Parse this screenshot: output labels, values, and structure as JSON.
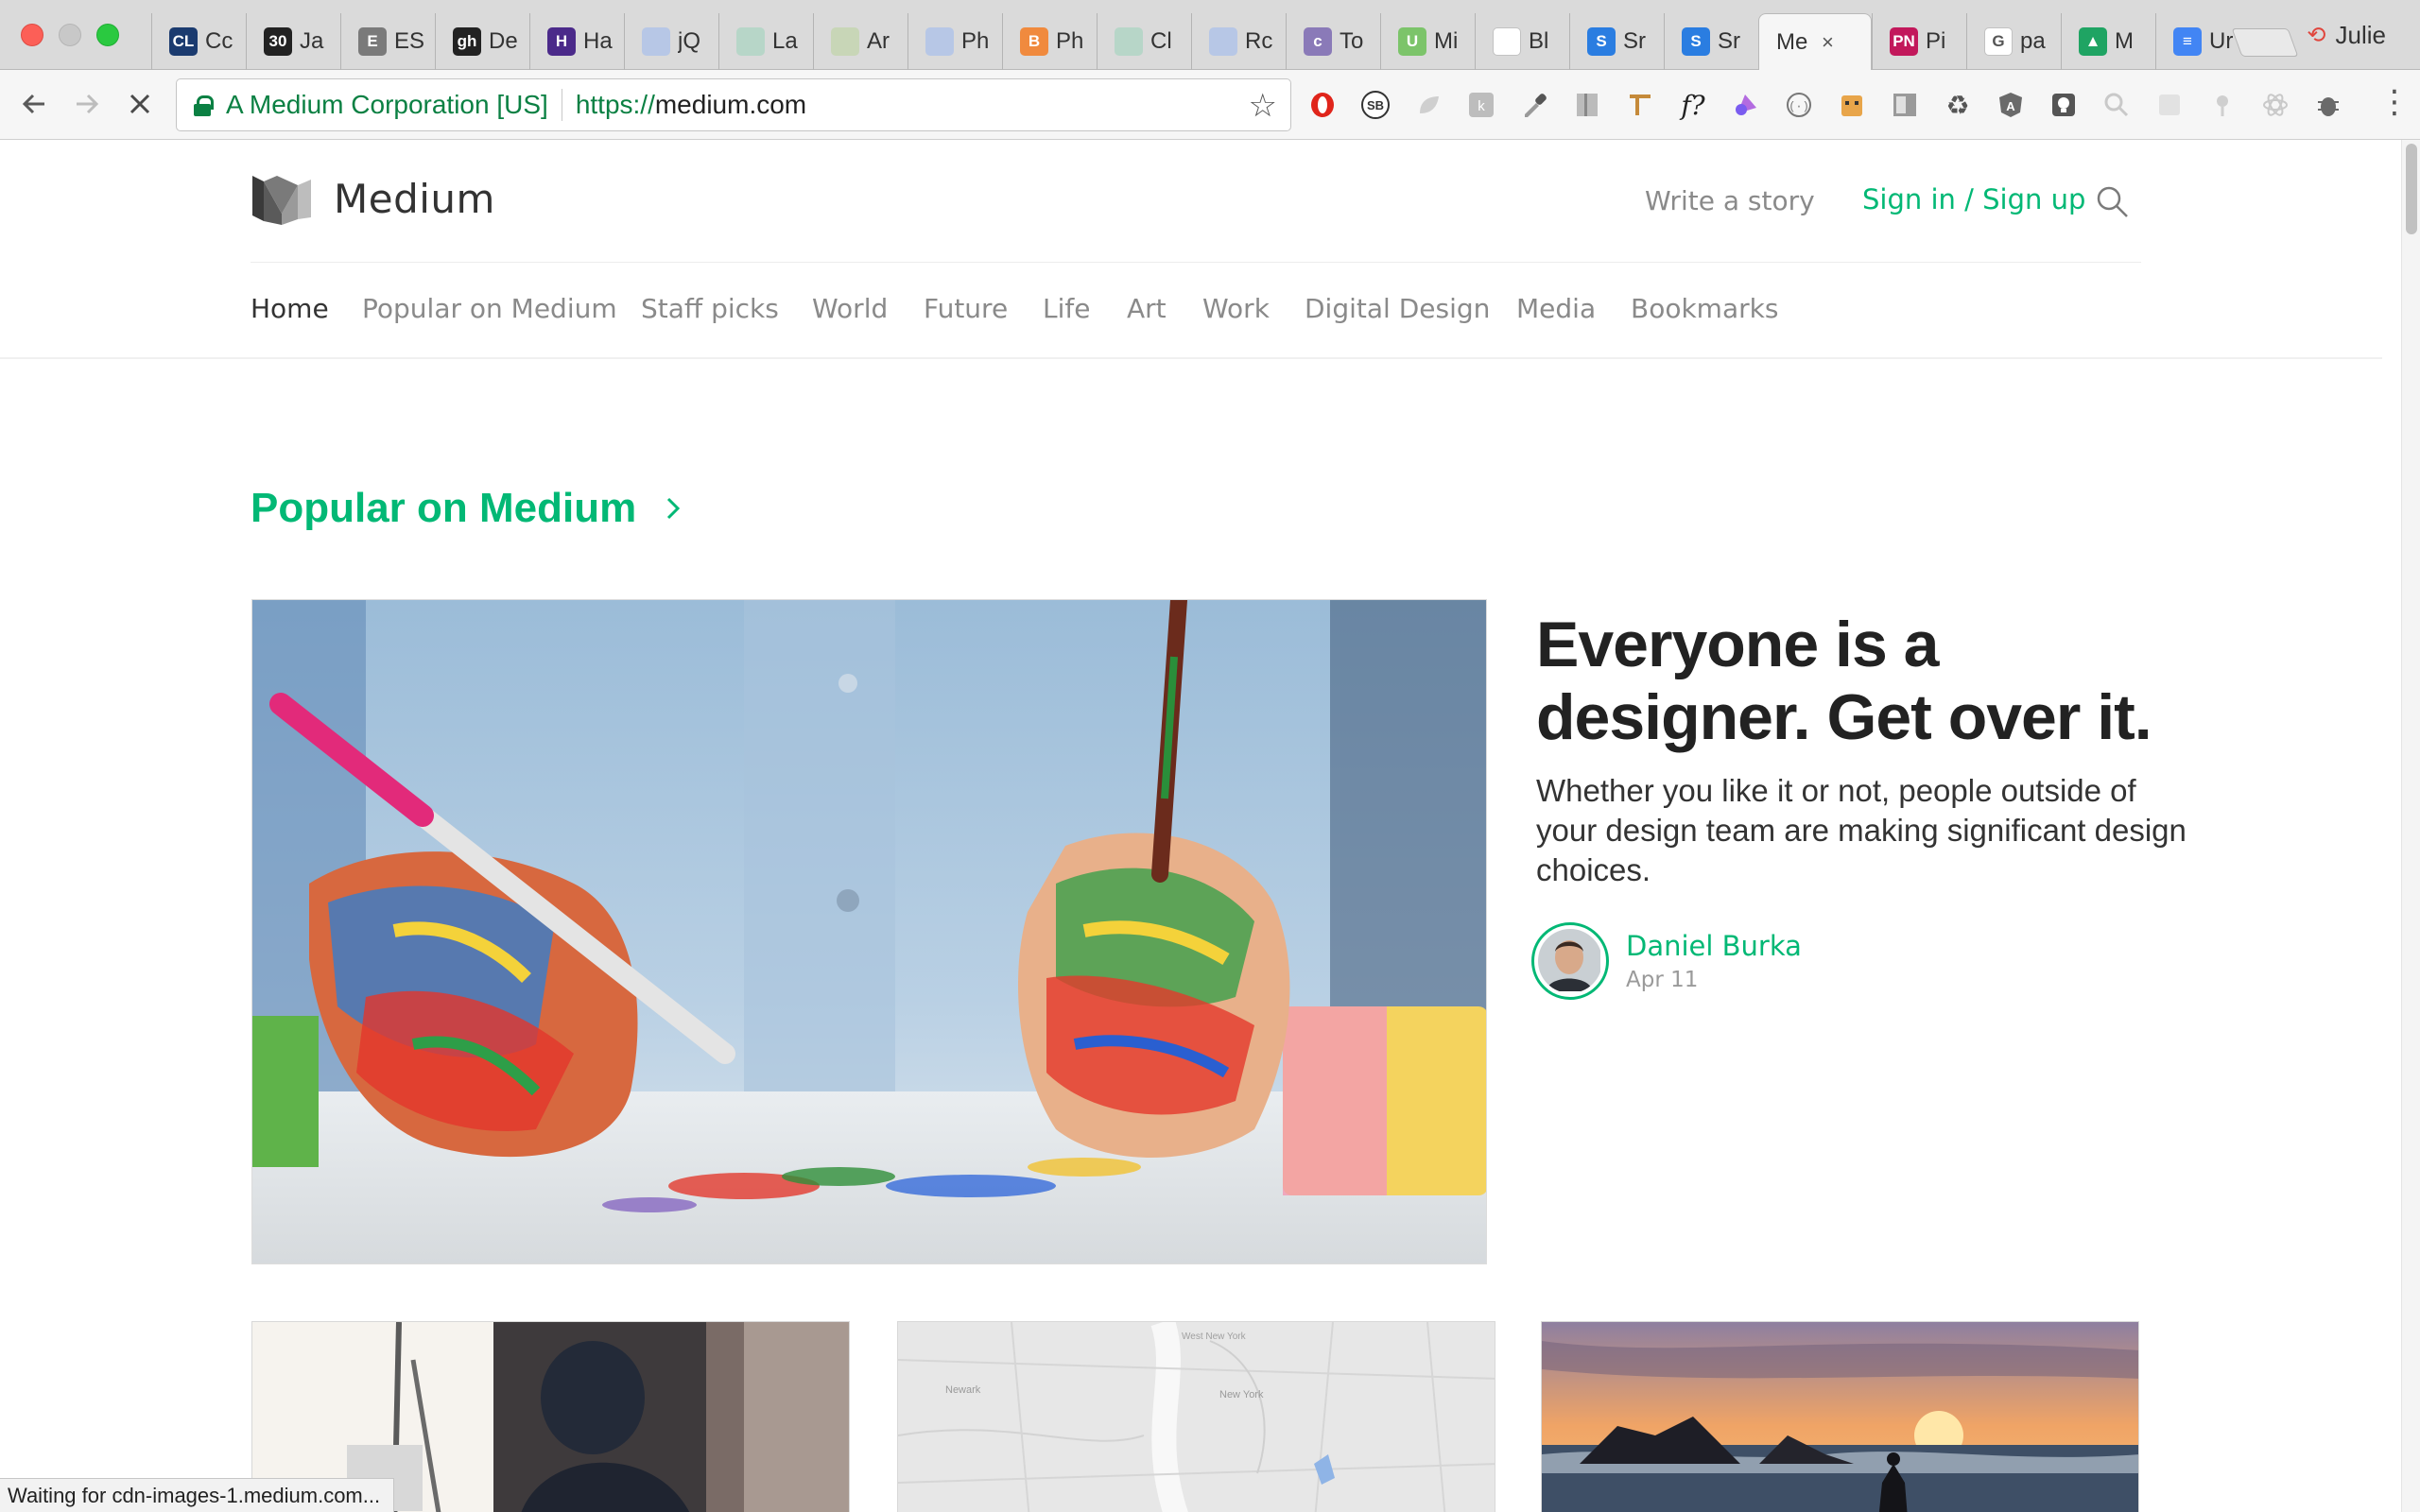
{
  "browser": {
    "tabs": [
      {
        "icon": "CL",
        "label": "Cc",
        "color": "#1b3b6f"
      },
      {
        "icon": "30",
        "label": "Ja",
        "color": "#222222"
      },
      {
        "icon": "E",
        "label": "ES",
        "color": "#7a7a7a"
      },
      {
        "icon": "gh",
        "label": "De",
        "color": "#222222"
      },
      {
        "icon": "H",
        "label": "Ha",
        "color": "#4b2a8a"
      },
      {
        "icon": "",
        "label": "jQ",
        "color": "#b7c7e6"
      },
      {
        "icon": "",
        "label": "La",
        "color": "#b7d6c8"
      },
      {
        "icon": "",
        "label": "Ar",
        "color": "#c8d6b7"
      },
      {
        "icon": "",
        "label": "Ph",
        "color": "#b7c7e6"
      },
      {
        "icon": "B",
        "label": "Ph",
        "color": "#f08a3e"
      },
      {
        "icon": "",
        "label": "Cl",
        "color": "#b7d6c8"
      },
      {
        "icon": "",
        "label": "Rc",
        "color": "#b7c7e6"
      },
      {
        "icon": "c",
        "label": "To",
        "color": "#8a7ab8"
      },
      {
        "icon": "U",
        "label": "Mi",
        "color": "#7cc46a"
      },
      {
        "icon": "",
        "label": "Bl",
        "color": "#ffffff"
      },
      {
        "icon": "S",
        "label": "Sr",
        "color": "#2a7de1"
      },
      {
        "icon": "S",
        "label": "Sr",
        "color": "#2a7de1"
      }
    ],
    "active_tab": {
      "label": "Me",
      "close": "×"
    },
    "tabs_after": [
      {
        "icon": "PN",
        "label": "Pi",
        "color": "#c2185b"
      },
      {
        "icon": "G",
        "label": "pa",
        "color": "#ffffff"
      },
      {
        "icon": "▲",
        "label": "M",
        "color": "#1fa463"
      },
      {
        "icon": "≡",
        "label": "Ur",
        "color": "#4285f4"
      }
    ],
    "profile_name": "Julie",
    "url": {
      "ev_label": "A Medium Corporation [US]",
      "scheme": "https://",
      "host": "medium.com"
    },
    "status_text": "Waiting for cdn-images-1.medium.com..."
  },
  "site": {
    "logo_text": "Medium",
    "write_link": "Write a story",
    "signin_link": "Sign in / Sign up",
    "nav": [
      "Home",
      "Popular on Medium",
      "Staff picks",
      "World",
      "Future",
      "Life",
      "Art",
      "Work",
      "Digital Design",
      "Media",
      "Bookmarks"
    ],
    "active_nav": "Home",
    "accent": "#02b875"
  },
  "section": {
    "title": "Popular on Medium"
  },
  "hero": {
    "title": "Everyone is a designer. Get over it.",
    "subtitle": "Whether you like it or not, people outside of your design team are making significant design choices.",
    "author": "Daniel Burka",
    "date": "Apr 11"
  }
}
